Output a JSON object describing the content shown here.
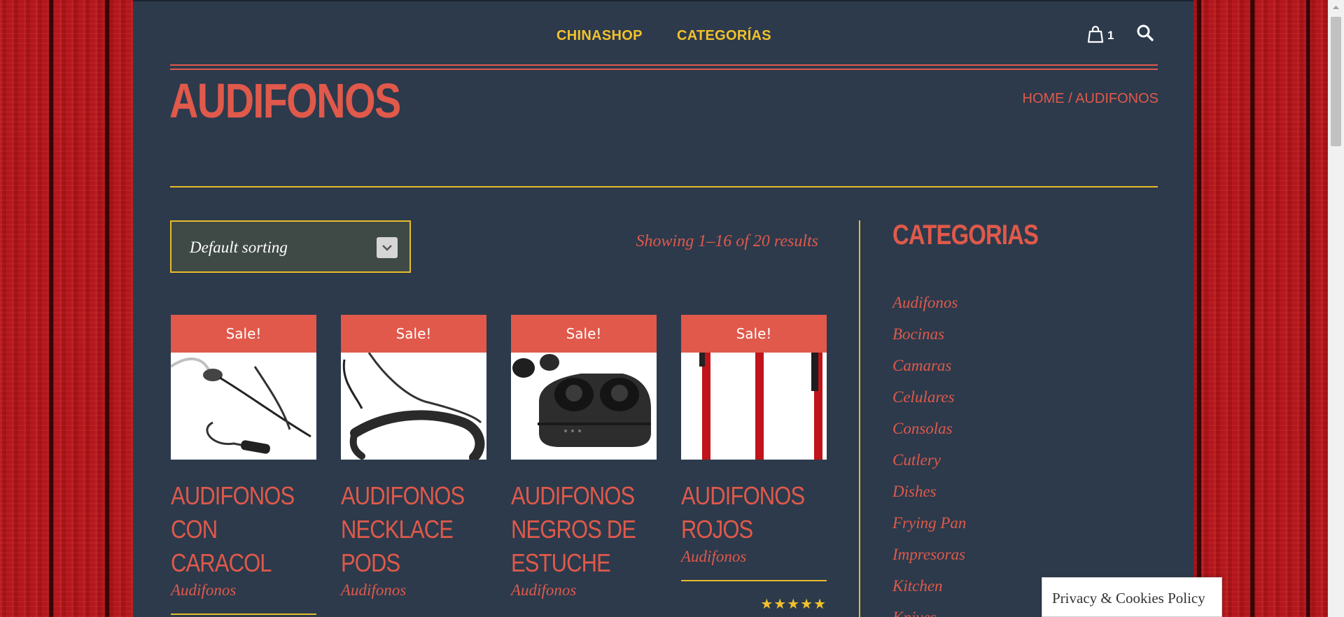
{
  "nav": {
    "links": [
      "CHINASHOP",
      "CATEGORÍAS"
    ],
    "cart_count": "1"
  },
  "page": {
    "title": "AUDIFONOS",
    "breadcrumb": {
      "home": "HOME",
      "separator": " / ",
      "current": "AUDIFONOS"
    }
  },
  "shop": {
    "sorting_selected": "Default sorting",
    "results_text": "Showing 1–16 of 20 results"
  },
  "products": [
    {
      "badge": "Sale!",
      "title": "AUDIFONOS CON CARACOL",
      "category": "Audifonos",
      "rating": "★★★★★",
      "image": "earbuds-remote-image"
    },
    {
      "badge": "Sale!",
      "title": "AUDIFONOS NECKLACE PODS",
      "category": "Audifonos",
      "rating": "",
      "image": "neckband-earphones-image"
    },
    {
      "badge": "Sale!",
      "title": "AUDIFONOS NEGROS DE ESTUCHE",
      "category": "Audifonos",
      "rating": "",
      "image": "earbuds-case-image"
    },
    {
      "badge": "Sale!",
      "title": "AUDIFONOS ROJOS",
      "category": "Audifonos",
      "rating": "★★★★★",
      "image": "red-earphones-image"
    }
  ],
  "sidebar": {
    "title": "CATEGORIAS",
    "categories": [
      "Audifonos",
      "Bocinas",
      "Camaras",
      "Celulares",
      "Consolas",
      "Cutlery",
      "Dishes",
      "Frying Pan",
      "Impresoras",
      "Kitchen",
      "Knives"
    ]
  },
  "cookie": {
    "text": "Privacy & Cookies Policy"
  },
  "colors": {
    "accent": "#e0594a",
    "nav_yellow": "#f2c22b",
    "panel": "#2c3a4c",
    "wood": "#b3161b"
  }
}
